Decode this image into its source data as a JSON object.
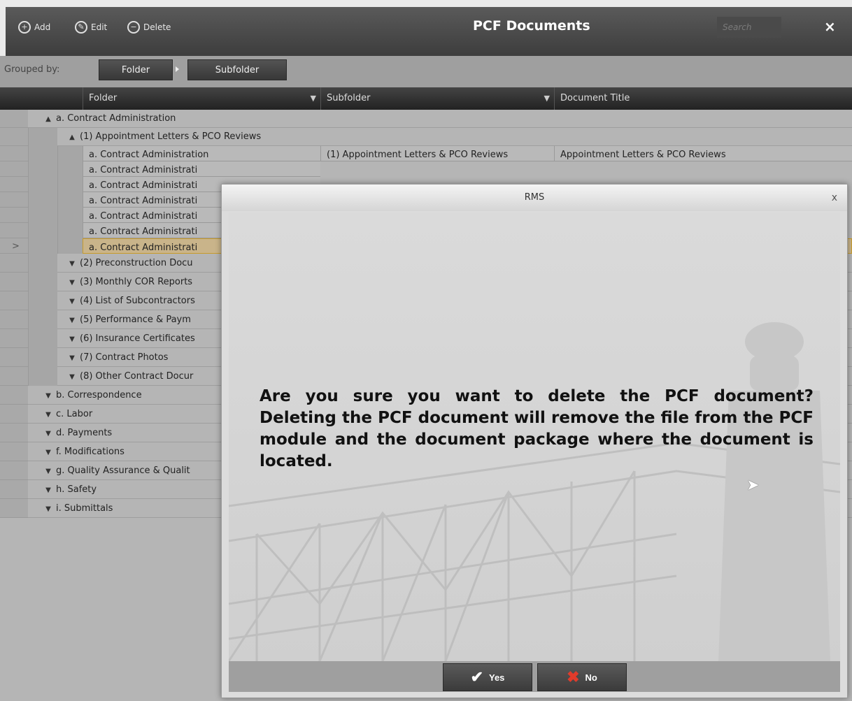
{
  "toolbar": {
    "add_label": "Add",
    "edit_label": "Edit",
    "delete_label": "Delete",
    "title": "PCF Documents",
    "search_placeholder": "Search",
    "close": "×"
  },
  "grouping": {
    "label": "Grouped by:",
    "chips": [
      "Folder",
      "Subfolder"
    ]
  },
  "columns": {
    "folder": "Folder",
    "subfolder": "Subfolder",
    "title": "Document Title"
  },
  "grid": {
    "top_group": "a. Contract Administration",
    "sub_group": "(1) Appointment Letters & PCO Reviews",
    "rows": [
      {
        "folder": "a. Contract Administration",
        "subfolder": "(1) Appointment Letters & PCO Reviews",
        "title": "Appointment Letters & PCO Reviews"
      },
      {
        "folder": "a. Contract Administrati"
      },
      {
        "folder": "a. Contract Administrati"
      },
      {
        "folder": "a. Contract Administrati"
      },
      {
        "folder": "a. Contract Administrati"
      },
      {
        "folder": "a. Contract Administrati"
      },
      {
        "folder": "a. Contract Administrati"
      }
    ],
    "current_marker": ">",
    "sub_groups_collapsed": [
      "(2) Preconstruction Docu",
      "(3) Monthly COR Reports",
      "(4) List of Subcontractors",
      "(5) Performance & Paym",
      "(6) Insurance Certificates",
      "(7) Contract Photos",
      "(8) Other Contract Docur"
    ],
    "top_groups_collapsed": [
      "b. Correspondence",
      "c. Labor",
      "d. Payments",
      "f. Modifications",
      "g. Quality Assurance & Qualit",
      "h. Safety",
      "i. Submittals"
    ]
  },
  "dialog": {
    "title": "RMS",
    "close": "x",
    "message": "Are you sure you want to delete the PCF document? Deleting the PCF document will remove the file from the PCF module and the document package where the document is located.",
    "yes_label": "Yes",
    "no_label": "No"
  },
  "colors": {
    "selected_row": "#c9b48a",
    "toolbar_bg": "#3d3d3d",
    "no_icon": "#e23b2b"
  },
  "icons": [
    "add-icon",
    "edit-icon",
    "delete-icon",
    "close-icon",
    "filter-icon",
    "expand-icon",
    "collapse-icon",
    "check-icon",
    "cross-icon",
    "mouse-pointer-icon"
  ]
}
